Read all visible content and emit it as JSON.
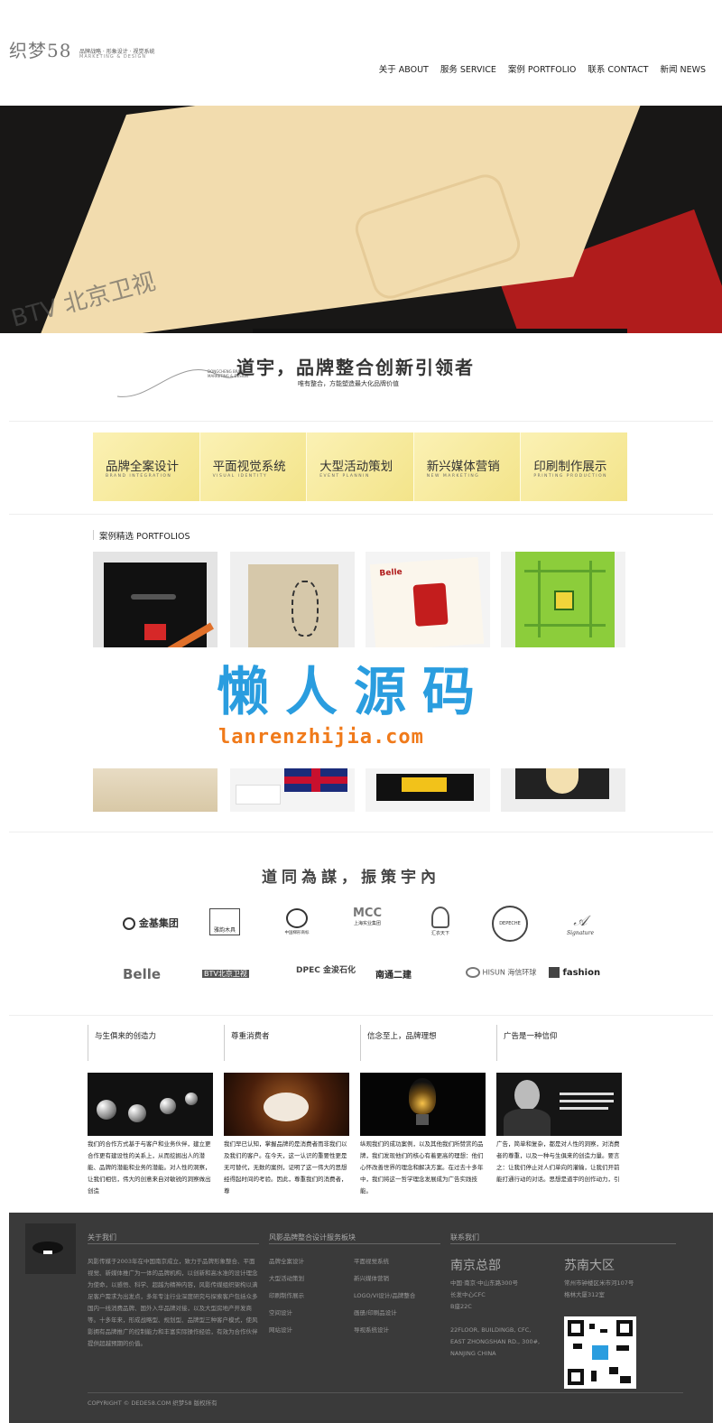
{
  "header": {
    "logo_mark": "织梦58",
    "logo_tag_cn": "品牌战略 · 形象设计 · 视觉系统",
    "logo_tag_en": "MARKETING & DESIGN",
    "nav": [
      {
        "label": "关于 ABOUT"
      },
      {
        "label": "服务 SERVICE"
      },
      {
        "label": "案例 PORTFOLIO"
      },
      {
        "label": "联系 CONTACT"
      },
      {
        "label": "新闻 NEWS"
      }
    ]
  },
  "banner": {
    "overlay_text": "BTV 北京卫视"
  },
  "slogan": {
    "main": "道宇，品牌整合创新引领者",
    "sub": "唯有整合，方能塑造最大化品牌价值",
    "en_line1": "DONGCHENG BRAND",
    "en_line2": "MARKETING & DESIGN"
  },
  "services": [
    {
      "cn": "品牌全案设计",
      "en": "BRAND INTEGRATION"
    },
    {
      "cn": "平面视觉系统",
      "en": "VISUAL IDENTITY"
    },
    {
      "cn": "大型活动策划",
      "en": "EVENT PLANNIN"
    },
    {
      "cn": "新兴媒体营销",
      "en": "NEW MARKETING"
    },
    {
      "cn": "印刷制作展示",
      "en": "PRINTING PRODUCTION"
    }
  ],
  "portfolio": {
    "title": "案例精选 PORTFOLIOS",
    "tile3_brand": "Belle"
  },
  "watermark": {
    "cn": "懒人源码",
    "en": "lanrenzhijia.com"
  },
  "clients": {
    "slogan": "道同為謀，振策宇內",
    "row1": [
      "金基集团",
      "雅韵木具",
      "中国梯形商标",
      "上海实业集团",
      "汇衣天下",
      "DEPECHE",
      "Signature"
    ],
    "row2": [
      "Belle",
      "BTV北京卫视",
      "DPEC 金浚石化",
      "南通二建",
      "HISUN 海信环球",
      "fashion"
    ]
  },
  "philosophy": [
    {
      "title": "与生俱来的创造力",
      "text": "我们的合作方式基于与客户和业务伙伴，建立更合作更有建设性的关系上，从而挖掘出人的潜能、品牌的潜能和业务的潜能。对人性的洞察，让我们相信，伟大的创意来自对敏锐的洞察做出创造"
    },
    {
      "title": "尊重消费者",
      "text": "我们早已认知，掌握品牌的是消费者而非我们以及我们的客户。在今天，这一认识的重要性更是无可替代，无数的案例，证明了这一伟大的思想经得起时间的考验。因此，尊重我们的消费者，尊"
    },
    {
      "title": "信念至上，品牌理想",
      "text": "纵观我们的成功案例，以及其他我们所赞赏的品牌，我们发现他们的核心有着更高的理想：他们心怀改善世界的理念和解决方案。在过去十多年中，我们将这一哲学理念发展成为广告实践技能。"
    },
    {
      "title": "广告是一种信仰",
      "text": "广告，简单和复杂，都是对人性的洞察，对消费者的尊重，以及一种与生俱来的创造力量。要言之：让我们停止对人们单向的灌输，让我们开前能打通行动的对话。思想是道宇的创作动力，引"
    }
  ],
  "footer": {
    "about_title": "关于我们",
    "about_text": "风影传媒于2003年在中国南京成立，致力于品牌形象整合、平面视觉、新媒体推广为一体的品牌机构，以创新和高水准的设计理念为使命，以感悟、科学、超越为精神内容，风影传媒组织架构以满足客户需求为出发点，多年专注行业深度研究与探索客户包括众多国内一线消费品牌、国外入华品牌对接，以及大型房地产开发商等。十多年来，形成战略型、规划型、品牌型三种客户模式，使风影拥有品牌推广的控制能力和丰富实际操作经验，有效为合作伙伴提供超越预期的价值。",
    "services_title": "风影品牌整合设计服务板块",
    "services_col1": [
      "品牌全案设计",
      "大型活动策划",
      "印刷制作展示",
      "空间设计",
      "网站设计"
    ],
    "services_col2": [
      "平面视觉系统",
      "新兴媒体营销",
      "LOGO/VI设计/品牌整合",
      "画册/印刷品设计",
      "导视系统设计"
    ],
    "contact_title": "联系我们",
    "hq_city": "南京总部",
    "hq_addr": [
      "中国·南京·中山东路300号",
      "长发中心CFC",
      "B座22C",
      "",
      "22FLOOR, BUILDINGB, CFC,",
      "EAST ZHONGSHAN RD., 300#,",
      "NANJING CHINA"
    ],
    "branch_city": "苏南大区",
    "branch_addr": [
      "常州市钟楼区米市河107号",
      "格林大厦312室"
    ],
    "copyright": "COPYRIGHT © DEDE58.COM 织梦58 版权所有"
  }
}
